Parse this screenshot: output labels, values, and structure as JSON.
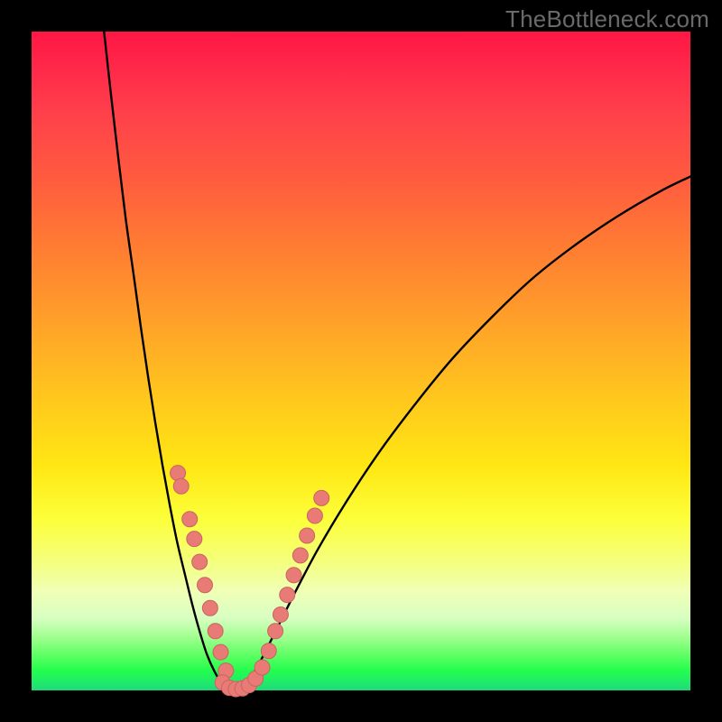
{
  "watermark": "TheBottleneck.com",
  "chart_data": {
    "type": "line",
    "title": "",
    "xlabel": "",
    "ylabel": "",
    "x_range": [
      0,
      100
    ],
    "y_range": [
      0,
      100
    ],
    "series": [
      {
        "name": "left-curve",
        "x": [
          11.0,
          12.1,
          13.2,
          14.3,
          15.5,
          16.6,
          17.7,
          18.8,
          19.9,
          21.0,
          22.1,
          23.3,
          24.4,
          25.5,
          26.6,
          27.7,
          28.8,
          29.9,
          30.7
        ],
        "y": [
          100.0,
          90.0,
          80.5,
          71.5,
          63.0,
          55.0,
          47.5,
          40.5,
          34.0,
          28.0,
          22.5,
          17.5,
          13.0,
          9.0,
          5.5,
          3.0,
          1.2,
          0.3,
          0.0
        ]
      },
      {
        "name": "right-curve",
        "x": [
          30.7,
          31.7,
          33.0,
          34.5,
          36.8,
          39.8,
          43.5,
          48.0,
          53.0,
          58.5,
          64.0,
          70.0,
          76.0,
          82.5,
          89.0,
          95.5,
          100.0
        ],
        "y": [
          0.0,
          0.3,
          1.5,
          4.0,
          8.5,
          14.5,
          21.5,
          29.0,
          36.5,
          43.8,
          50.5,
          56.8,
          62.5,
          67.6,
          72.0,
          75.8,
          78.0
        ]
      }
    ],
    "points": [
      {
        "name": "left-cluster",
        "x": 22.2,
        "y": 33.0
      },
      {
        "name": "left-cluster",
        "x": 22.7,
        "y": 31.0
      },
      {
        "name": "left-cluster",
        "x": 24.0,
        "y": 26.0
      },
      {
        "name": "left-cluster",
        "x": 24.7,
        "y": 23.0
      },
      {
        "name": "left-cluster",
        "x": 25.5,
        "y": 19.5
      },
      {
        "name": "left-cluster",
        "x": 26.3,
        "y": 16.0
      },
      {
        "name": "left-cluster",
        "x": 27.1,
        "y": 12.5
      },
      {
        "name": "left-cluster",
        "x": 27.9,
        "y": 9.0
      },
      {
        "name": "left-cluster",
        "x": 28.7,
        "y": 5.8
      },
      {
        "name": "left-cluster",
        "x": 29.5,
        "y": 3.0
      },
      {
        "name": "bottom-cluster",
        "x": 29.0,
        "y": 1.2
      },
      {
        "name": "bottom-cluster",
        "x": 30.0,
        "y": 0.4
      },
      {
        "name": "bottom-cluster",
        "x": 31.0,
        "y": 0.2
      },
      {
        "name": "bottom-cluster",
        "x": 32.0,
        "y": 0.3
      },
      {
        "name": "bottom-cluster",
        "x": 33.0,
        "y": 0.8
      },
      {
        "name": "bottom-cluster",
        "x": 34.0,
        "y": 1.8
      },
      {
        "name": "right-cluster",
        "x": 35.0,
        "y": 3.5
      },
      {
        "name": "right-cluster",
        "x": 36.0,
        "y": 6.0
      },
      {
        "name": "right-cluster",
        "x": 37.0,
        "y": 9.0
      },
      {
        "name": "right-cluster",
        "x": 37.8,
        "y": 11.5
      },
      {
        "name": "right-cluster",
        "x": 38.8,
        "y": 14.5
      },
      {
        "name": "right-cluster",
        "x": 39.8,
        "y": 17.5
      },
      {
        "name": "right-cluster",
        "x": 40.8,
        "y": 20.5
      },
      {
        "name": "right-cluster",
        "x": 41.8,
        "y": 23.5
      },
      {
        "name": "right-cluster",
        "x": 43.0,
        "y": 26.5
      },
      {
        "name": "right-cluster",
        "x": 44.0,
        "y": 29.2
      }
    ],
    "gradient_note": "Background encodes value: red (high/bad) at top through orange, yellow, to green (low/good) at bottom."
  }
}
